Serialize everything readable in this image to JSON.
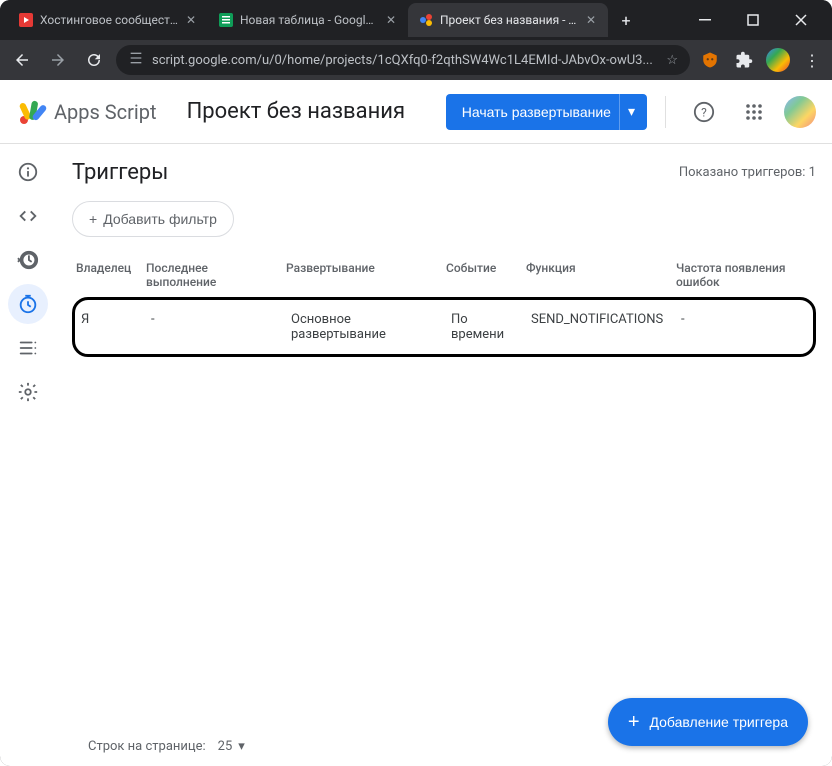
{
  "browser": {
    "tabs": [
      {
        "title": "Хостинговое сообщество"
      },
      {
        "title": "Новая таблица - Google Т"
      },
      {
        "title": "Проект без названия - Три"
      }
    ],
    "url": "script.google.com/u/0/home/projects/1cQXfq0-f2qthSW4Wc1L4EMId-JAbvOx-owU3..."
  },
  "header": {
    "app_name": "Apps Script",
    "project_title": "Проект без названия",
    "deploy_label": "Начать развертывание"
  },
  "page": {
    "title": "Триггеры",
    "count_label": "Показано триггеров: 1",
    "filter_chip": "Добавить фильтр",
    "columns": {
      "owner": "Владелец",
      "last_run": "Последнее выполнение",
      "deployment": "Развертывание",
      "event": "Событие",
      "function": "Функция",
      "error_rate": "Частота появления ошибок"
    },
    "rows": [
      {
        "owner": "Я",
        "last_run": "-",
        "deployment": "Основное развертывание",
        "event": "По времени",
        "function": "SEND_NOTIFICATIONS",
        "error_rate": "-"
      }
    ],
    "footer": {
      "rows_label": "Строк на странице:",
      "rows_value": "25"
    },
    "fab_label": "Добавление триггера"
  }
}
